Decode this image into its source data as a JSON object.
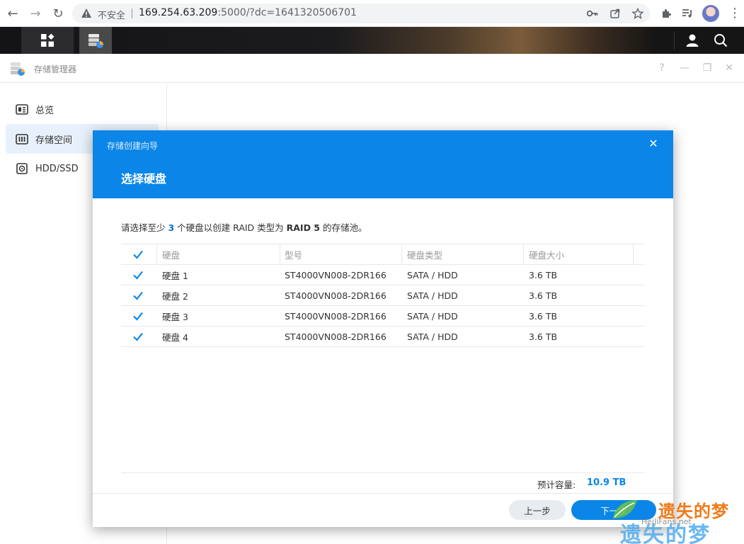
{
  "browser": {
    "security_label": "不安全",
    "url_host": "169.254.63.209",
    "url_rest": ":5000/?dc=1641320506701"
  },
  "app": {
    "title": "存储管理器",
    "window_controls": [
      "?",
      "—",
      "❐",
      "✕"
    ]
  },
  "sidebar": {
    "items": [
      {
        "label": "总览",
        "icon": "overview-icon"
      },
      {
        "label": "存储空间",
        "icon": "storage-icon",
        "active": true
      },
      {
        "label": "HDD/SSD",
        "icon": "disk-icon"
      }
    ]
  },
  "wizard": {
    "caption": "存储创建向导",
    "step_title": "选择硬盘",
    "instruction": {
      "part1": "请选择至少 ",
      "min_count": "3",
      "part2": " 个硬盘以创建 RAID 类型为 ",
      "raid_type": "RAID 5",
      "part3": " 的存储池。"
    },
    "table": {
      "headers": [
        "硬盘",
        "型号",
        "硬盘类型",
        "硬盘大小"
      ],
      "rows": [
        {
          "name": "硬盘 1",
          "model": "ST4000VN008-2DR166",
          "type": "SATA / HDD",
          "size": "3.6 TB"
        },
        {
          "name": "硬盘 2",
          "model": "ST4000VN008-2DR166",
          "type": "SATA / HDD",
          "size": "3.6 TB"
        },
        {
          "name": "硬盘 3",
          "model": "ST4000VN008-2DR166",
          "type": "SATA / HDD",
          "size": "3.6 TB"
        },
        {
          "name": "硬盘 4",
          "model": "ST4000VN008-2DR166",
          "type": "SATA / HDD",
          "size": "3.6 TB"
        }
      ]
    },
    "capacity_label": "预计容量:",
    "capacity_value": "10.9 TB",
    "prev_label": "上一步",
    "next_label": "下一步"
  },
  "watermark": {
    "top": "遗失的梦",
    "mid": "HeiJiFans.net",
    "bottom": "遗失的梦"
  },
  "colors": {
    "accent": "#0b86e8",
    "sidebar_active": "#e8f1fb"
  }
}
